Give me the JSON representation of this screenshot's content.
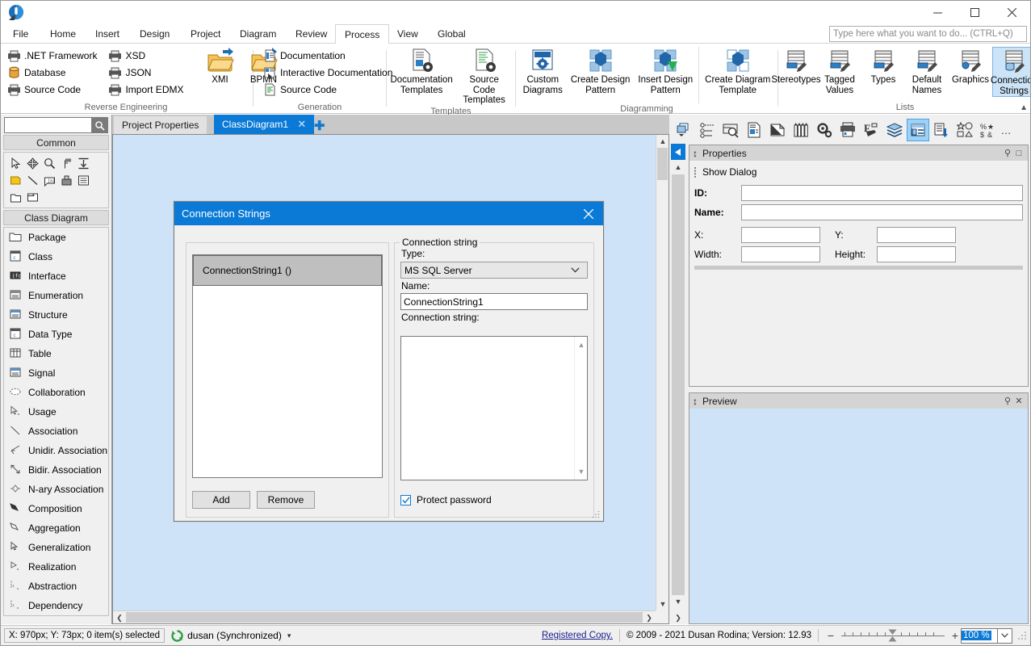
{
  "window": {
    "minimize_label": "─",
    "maximize_label": "□",
    "close_label": "✕"
  },
  "global_search": {
    "placeholder": "Type here what you want to do... (CTRL+Q)",
    "value": ""
  },
  "ribbon": {
    "tabs": [
      {
        "label": "File",
        "active": false
      },
      {
        "label": "Home",
        "active": false
      },
      {
        "label": "Insert",
        "active": false
      },
      {
        "label": "Design",
        "active": false
      },
      {
        "label": "Project",
        "active": false
      },
      {
        "label": "Diagram",
        "active": false
      },
      {
        "label": "Review",
        "active": false
      },
      {
        "label": "Process",
        "active": true
      },
      {
        "label": "View",
        "active": false
      },
      {
        "label": "Global",
        "active": false
      }
    ],
    "groups": [
      {
        "title": "Reverse Engineering",
        "small_items_col1": [
          {
            "label": ".NET Framework",
            "icon": "import-printer-icon"
          },
          {
            "label": "Database",
            "icon": "database-icon"
          },
          {
            "label": "Source Code",
            "icon": "import-printer-icon"
          }
        ],
        "small_items_col2": [
          {
            "label": "XSD",
            "icon": "import-printer-icon"
          },
          {
            "label": "JSON",
            "icon": "import-printer-icon"
          },
          {
            "label": "Import EDMX",
            "icon": "import-printer-icon"
          }
        ],
        "big_items": [
          {
            "label": "XMI",
            "icon": "folder-import-icon"
          },
          {
            "label": "BPMN",
            "icon": "folder-import-icon"
          }
        ]
      },
      {
        "title": "Generation",
        "small_items_col1": [
          {
            "label": "Documentation",
            "icon": "document-icon"
          },
          {
            "label": "Interactive Documentation",
            "icon": "interactive-doc-icon"
          },
          {
            "label": "Source Code",
            "icon": "source-code-icon"
          }
        ],
        "big_items": []
      },
      {
        "title": "Templates",
        "big_items": [
          {
            "label": "Documentation\nTemplates",
            "line1": "Documentation",
            "line2": "Templates",
            "icon": "doc-template-icon"
          },
          {
            "label": "Source Code\nTemplates",
            "line1": "Source Code",
            "line2": "Templates",
            "icon": "code-template-icon"
          }
        ]
      },
      {
        "title": "Diagramming",
        "big_items": [
          {
            "line1": "Custom",
            "line2": "Diagrams",
            "icon": "custom-diagram-icon"
          },
          {
            "line1": "Create Design",
            "line2": "Pattern",
            "icon": "design-pattern-icon"
          },
          {
            "line1": "Insert Design",
            "line2": "Pattern",
            "icon": "insert-pattern-icon"
          },
          {
            "line1": "Create Diagram",
            "line2": "Template",
            "icon": "diagram-template-icon"
          }
        ]
      },
      {
        "title": "Lists",
        "big_items": [
          {
            "line1": "Stereotypes",
            "line2": "",
            "icon": "stereotypes-icon",
            "selected": false
          },
          {
            "line1": "Tagged",
            "line2": "Values",
            "icon": "tagged-values-icon",
            "selected": false
          },
          {
            "line1": "Types",
            "line2": "",
            "icon": "types-icon",
            "selected": false
          },
          {
            "line1": "Default",
            "line2": "Names",
            "icon": "default-names-icon",
            "selected": false
          },
          {
            "line1": "Graphics",
            "line2": "",
            "icon": "graphics-icon",
            "selected": false
          },
          {
            "line1": "Connection",
            "line2": "Strings",
            "icon": "connection-strings-icon",
            "selected": true
          }
        ]
      }
    ],
    "collapse_label": "▲"
  },
  "toolbox": {
    "search": {
      "value": "",
      "placeholder": ""
    },
    "search_icon": "magnifier-icon",
    "sections": [
      {
        "header": "Common"
      },
      {
        "header": "Class Diagram"
      }
    ],
    "palette_icons": [
      "pointer-icon",
      "move-icon",
      "zoom-icon",
      "format-painter-icon",
      "align-icon",
      "note-icon",
      "line-icon",
      "text-box-icon",
      "image-icon",
      "list-icon",
      "package-icon",
      "frame-icon"
    ],
    "items": [
      {
        "label": "Package",
        "icon": "package-icon"
      },
      {
        "label": "Class",
        "icon": "class-icon"
      },
      {
        "label": "Interface",
        "icon": "interface-icon"
      },
      {
        "label": "Enumeration",
        "icon": "enumeration-icon"
      },
      {
        "label": "Structure",
        "icon": "structure-icon"
      },
      {
        "label": "Data Type",
        "icon": "data-type-icon"
      },
      {
        "label": "Table",
        "icon": "table-icon"
      },
      {
        "label": "Signal",
        "icon": "signal-icon"
      },
      {
        "label": "Collaboration",
        "icon": "collaboration-icon"
      },
      {
        "label": "Usage",
        "icon": "usage-icon"
      },
      {
        "label": "Association",
        "icon": "association-icon"
      },
      {
        "label": "Unidir. Association",
        "icon": "unidir-association-icon"
      },
      {
        "label": "Bidir. Association",
        "icon": "bidir-association-icon"
      },
      {
        "label": "N-ary Association",
        "icon": "nary-association-icon"
      },
      {
        "label": "Composition",
        "icon": "composition-icon"
      },
      {
        "label": "Aggregation",
        "icon": "aggregation-icon"
      },
      {
        "label": "Generalization",
        "icon": "generalization-icon"
      },
      {
        "label": "Realization",
        "icon": "realization-icon"
      },
      {
        "label": "Abstraction",
        "icon": "abstraction-icon"
      },
      {
        "label": "Dependency",
        "icon": "dependency-icon"
      }
    ]
  },
  "document_tabs": {
    "tabs": [
      {
        "label": "Project Properties",
        "active": false,
        "closable": false
      },
      {
        "label": "ClassDiagram1",
        "active": true,
        "closable": true,
        "close_label": "✕"
      }
    ],
    "add_tab_label": "✚"
  },
  "canvas": {
    "background": "#cfe3f8"
  },
  "right_panel": {
    "toolbar_icons": [
      "diagram-list-icon",
      "model-tree-icon",
      "search-model-icon",
      "documentation-icon",
      "edit-note-icon",
      "palette-icon",
      "settings-icon",
      "printer-icon",
      "format-icon",
      "layers-icon",
      "connection-strings-panel-icon",
      "validate-icon",
      "shapes-icon",
      "misc-icon"
    ],
    "more_label": "…",
    "properties": {
      "title": "Properties",
      "pin_label": "⚲",
      "maximize_label": "□",
      "show_dialog_label": "Show Dialog",
      "fields": [
        {
          "label": "ID:",
          "value": "",
          "bold": true
        },
        {
          "label": "Name:",
          "value": "",
          "bold": true
        }
      ],
      "x_label": "X:",
      "x_value": "",
      "y_label": "Y:",
      "y_value": "",
      "width_label": "Width:",
      "width_value": "",
      "height_label": "Height:",
      "height_value": ""
    },
    "preview": {
      "title": "Preview",
      "pin_label": "⚲",
      "close_label": "✕"
    }
  },
  "dialog": {
    "title": "Connection Strings",
    "close_label": "✕",
    "list": {
      "items": [
        {
          "label": "ConnectionString1 ()",
          "selected": true
        }
      ]
    },
    "add_label": "Add",
    "remove_label": "Remove",
    "group_legend": "Connection string",
    "type_label": "Type:",
    "type_value": "MS SQL Server",
    "type_options": [
      "MS SQL Server"
    ],
    "name_label": "Name:",
    "name_value": "ConnectionString1",
    "connection_string_label": "Connection string:",
    "connection_string_value": "",
    "protect_password_label": "Protect password",
    "protect_password_checked": true
  },
  "status_bar": {
    "coordinates": "X: 970px; Y: 73px; 0 item(s) selected",
    "sync_user": "dusan (Synchronized)",
    "sync_caret": "▾",
    "registered": "Registered Copy.",
    "copyright": "© 2009 - 2021 Dusan Rodina; Version: 12.93",
    "zoom_minus": "−",
    "zoom_plus": "+",
    "zoom_value": "100 %",
    "zoom_caret": "⌄"
  },
  "colors": {
    "accent": "#0a7ad6",
    "canvas": "#cfe3f8",
    "panel": "#f0f0f0",
    "selected_ribbon": "#cce4f7"
  }
}
